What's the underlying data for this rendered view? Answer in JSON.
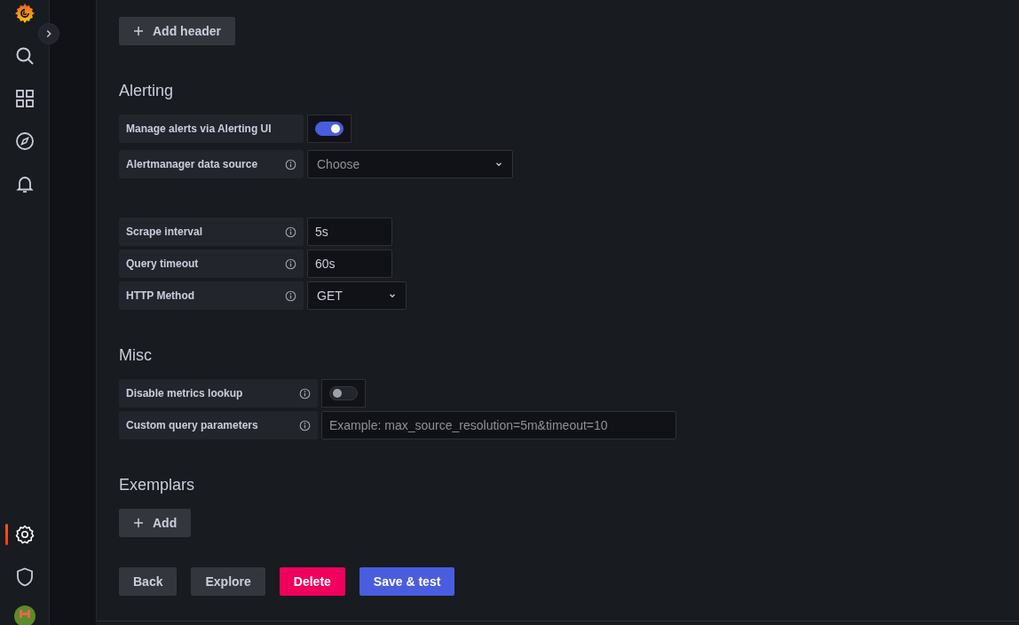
{
  "sidebar": {
    "items": [
      {
        "selected": false
      },
      {
        "selected": false
      },
      {
        "selected": false
      },
      {
        "selected": false
      }
    ],
    "bottom_items": [
      {
        "selected": true
      },
      {
        "selected": false
      }
    ]
  },
  "headers": {
    "add_button": "Add header"
  },
  "sections": [
    {
      "title": "Alerting",
      "rows": [
        {
          "kind": "toggle",
          "label": "Manage alerts via Alerting UI",
          "info": false,
          "on": true
        },
        {
          "kind": "select",
          "label": "Alertmanager data source",
          "info": true,
          "placeholder": "Choose"
        }
      ]
    },
    {
      "rows": [
        {
          "kind": "input",
          "label": "Scrape interval",
          "info": true,
          "value": "5s"
        },
        {
          "kind": "input",
          "label": "Query timeout",
          "info": true,
          "value": "60s"
        },
        {
          "kind": "select",
          "label": "HTTP Method",
          "info": true,
          "value": "GET"
        }
      ]
    },
    {
      "title": "Misc",
      "rows": [
        {
          "kind": "toggle",
          "label": "Disable metrics lookup",
          "info": true,
          "on": false
        },
        {
          "kind": "input",
          "label": "Custom query parameters",
          "info": true,
          "placeholder": "Example: max_source_resolution=5m&timeout=10"
        }
      ]
    }
  ],
  "exemplars": {
    "title": "Exemplars",
    "add_button": "Add"
  },
  "actions": [
    {
      "kind": "secondary",
      "label": "Back"
    },
    {
      "kind": "secondary",
      "label": "Explore"
    },
    {
      "kind": "destructive",
      "label": "Delete"
    },
    {
      "kind": "primary",
      "label": "Save & test"
    }
  ]
}
